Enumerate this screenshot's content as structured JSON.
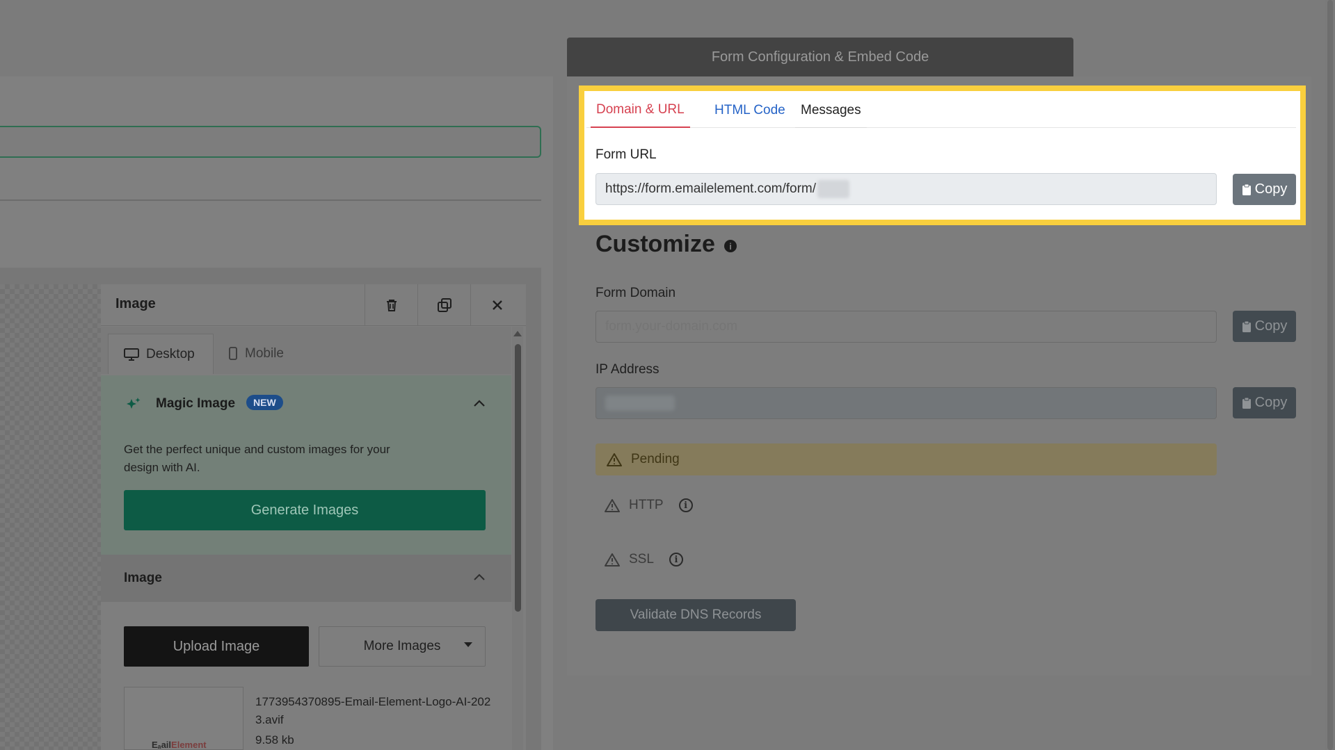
{
  "modal": {
    "title": "Form Configuration & Embed Code",
    "tabs": [
      {
        "label": "Domain & URL",
        "active": true
      },
      {
        "label": "HTML Code",
        "active": false
      },
      {
        "label": "Messages",
        "active": false
      }
    ],
    "form_url_label": "Form URL",
    "form_url_value": "https://form.emailelement.com/form/",
    "copy_label": "Copy",
    "customize_title": "Customize",
    "info_glyph": "i",
    "form_domain_label": "Form Domain",
    "form_domain_placeholder": "form.your-domain.com",
    "ip_address_label": "IP Address",
    "pending_label": "Pending",
    "http_label": "HTTP",
    "ssl_label": "SSL",
    "validate_button": "Validate DNS Records",
    "highlight_color": "#f9cf3e",
    "active_tab_color": "#d64150"
  },
  "image_panel": {
    "title": "Image",
    "tabs": {
      "desktop": "Desktop",
      "mobile": "Mobile"
    },
    "magic_title": "Magic Image",
    "new_badge": "NEW",
    "magic_desc": "Get the perfect unique and custom images for your design with AI.",
    "generate_button": "Generate Images",
    "image_section_title": "Image",
    "upload_button": "Upload Image",
    "more_images_button": "More Images",
    "file_name": "1773954370895-Email-Element-Logo-AI-2023.avif",
    "file_size": "9.58 kb",
    "thumb_logo_a": "Eₐail",
    "thumb_logo_b": "Element"
  }
}
